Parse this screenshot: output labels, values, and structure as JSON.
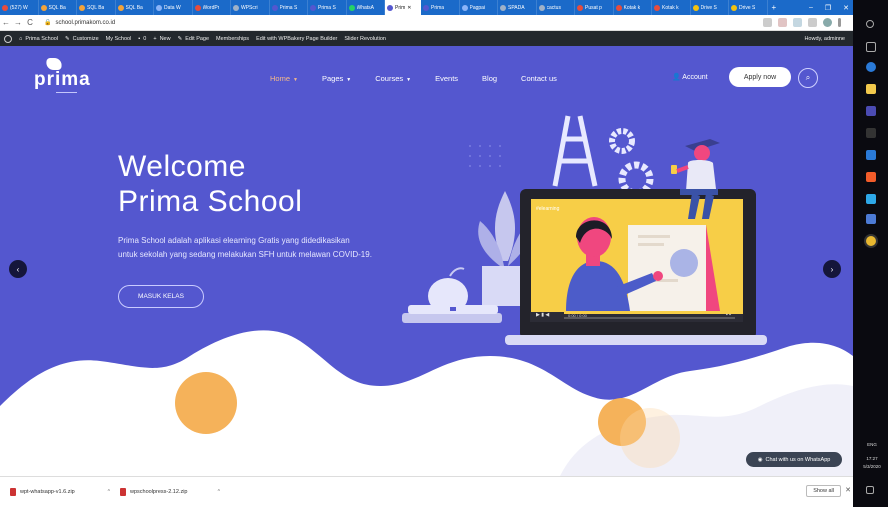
{
  "browser": {
    "tabs": [
      {
        "label": "(527) W",
        "color": "#e74c3c"
      },
      {
        "label": "SQL Ba",
        "color": "#f2a33a"
      },
      {
        "label": "SQL Ba",
        "color": "#f2a33a"
      },
      {
        "label": "SQL Ba",
        "color": "#f2a33a"
      },
      {
        "label": "Data W",
        "color": "#8ab4f8"
      },
      {
        "label": "WordPr",
        "color": "#e74c3c"
      },
      {
        "label": "WPScri",
        "color": "#9fb1c8"
      },
      {
        "label": "Prima S",
        "color": "#5457cf"
      },
      {
        "label": "Prima S",
        "color": "#5457cf"
      },
      {
        "label": "WhatsA",
        "color": "#25d366"
      },
      {
        "label": "Prim",
        "color": "#5457cf"
      },
      {
        "label": "Prima",
        "color": "#5457cf"
      },
      {
        "label": "Pagpai",
        "color": "#8ab4f8"
      },
      {
        "label": "SPADA",
        "color": "#9fb1c8"
      },
      {
        "label": "cactus",
        "color": "#9fb1c8"
      },
      {
        "label": "Pusat p",
        "color": "#e74c3c"
      },
      {
        "label": "Kotak k",
        "color": "#e74c3c"
      },
      {
        "label": "Kotak k",
        "color": "#e74c3c"
      },
      {
        "label": "Drive S",
        "color": "#f4c20d"
      },
      {
        "label": "Drive S",
        "color": "#f4c20d"
      }
    ],
    "active_tab_index": 10,
    "new_tab": "+",
    "window_controls": [
      "–",
      "❐",
      "✕"
    ],
    "url": "school.primakom.co.id",
    "nav": {
      "back": "←",
      "forward": "→",
      "reload": "C"
    }
  },
  "wp_admin_bar": {
    "site": "Prima School",
    "customize": "Customize",
    "my_school": "My School",
    "comments": "0",
    "new": "New",
    "edit_page": "Edit Page",
    "memberships": "Memberships",
    "wpbakery": "Edit with WPBakery Page Builder",
    "slider": "Slider Revolution",
    "howdy": "Howdy, adminne"
  },
  "site": {
    "logo_text": "prima",
    "nav": [
      {
        "label": "Home",
        "has_caret": true,
        "active": true
      },
      {
        "label": "Pages",
        "has_caret": true,
        "active": false
      },
      {
        "label": "Courses",
        "has_caret": true,
        "active": false
      },
      {
        "label": "Events",
        "has_caret": false,
        "active": false
      },
      {
        "label": "Blog",
        "has_caret": false,
        "active": false
      },
      {
        "label": "Contact us",
        "has_caret": false,
        "active": false
      }
    ],
    "account": "Account",
    "apply": "Apply now",
    "hero": {
      "title_line1": "Welcome",
      "title_line2": "Prima School",
      "desc_line1": "Prima School adalah aplikasi elearning Gratis yang didedikasikan",
      "desc_line2": "untuk sekolah yang sedang melakukan SFH untuk melawan COVID-19.",
      "cta": "MASUK KELAS",
      "screen_tag": "#elearning",
      "player_time": "0:00 / 0:00"
    },
    "chat": "Chat with us on WhatsApp",
    "colors": {
      "hero_bg": "#5457cf",
      "accent": "#f5b98a",
      "circle": "#f5b25a"
    }
  },
  "downloads": {
    "items": [
      {
        "name": "wpt-whatsapp-v1.6.zip"
      },
      {
        "name": "wpschoolpress-2.12.zip"
      }
    ],
    "show_all": "Show all"
  },
  "taskbar": {
    "time": "17:27",
    "date": "5/3/2020",
    "lang": "ENG"
  }
}
